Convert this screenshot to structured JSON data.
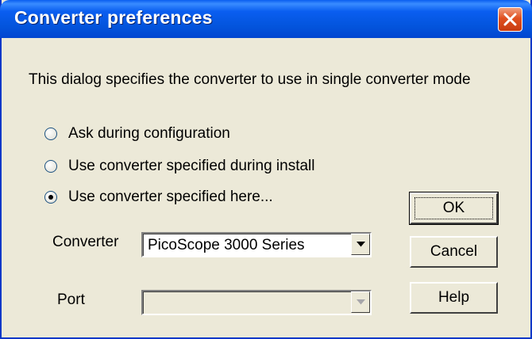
{
  "window": {
    "title": "Converter preferences"
  },
  "description": "This dialog specifies the converter to use in single converter mode",
  "options": [
    {
      "label": "Ask during configuration",
      "checked": false
    },
    {
      "label": "Use converter specified during install",
      "checked": false
    },
    {
      "label": "Use converter specified here...",
      "checked": true
    }
  ],
  "converter": {
    "label": "Converter",
    "value": "PicoScope 3000 Series"
  },
  "port": {
    "label": "Port",
    "value": "",
    "enabled": false
  },
  "buttons": {
    "ok": "OK",
    "cancel": "Cancel",
    "help": "Help"
  },
  "colors": {
    "titlebar": "#0354dc",
    "background": "#ece9d8",
    "close": "#e05020"
  },
  "icons": {
    "close": "close-icon",
    "dropdown": "chevron-down-icon"
  }
}
